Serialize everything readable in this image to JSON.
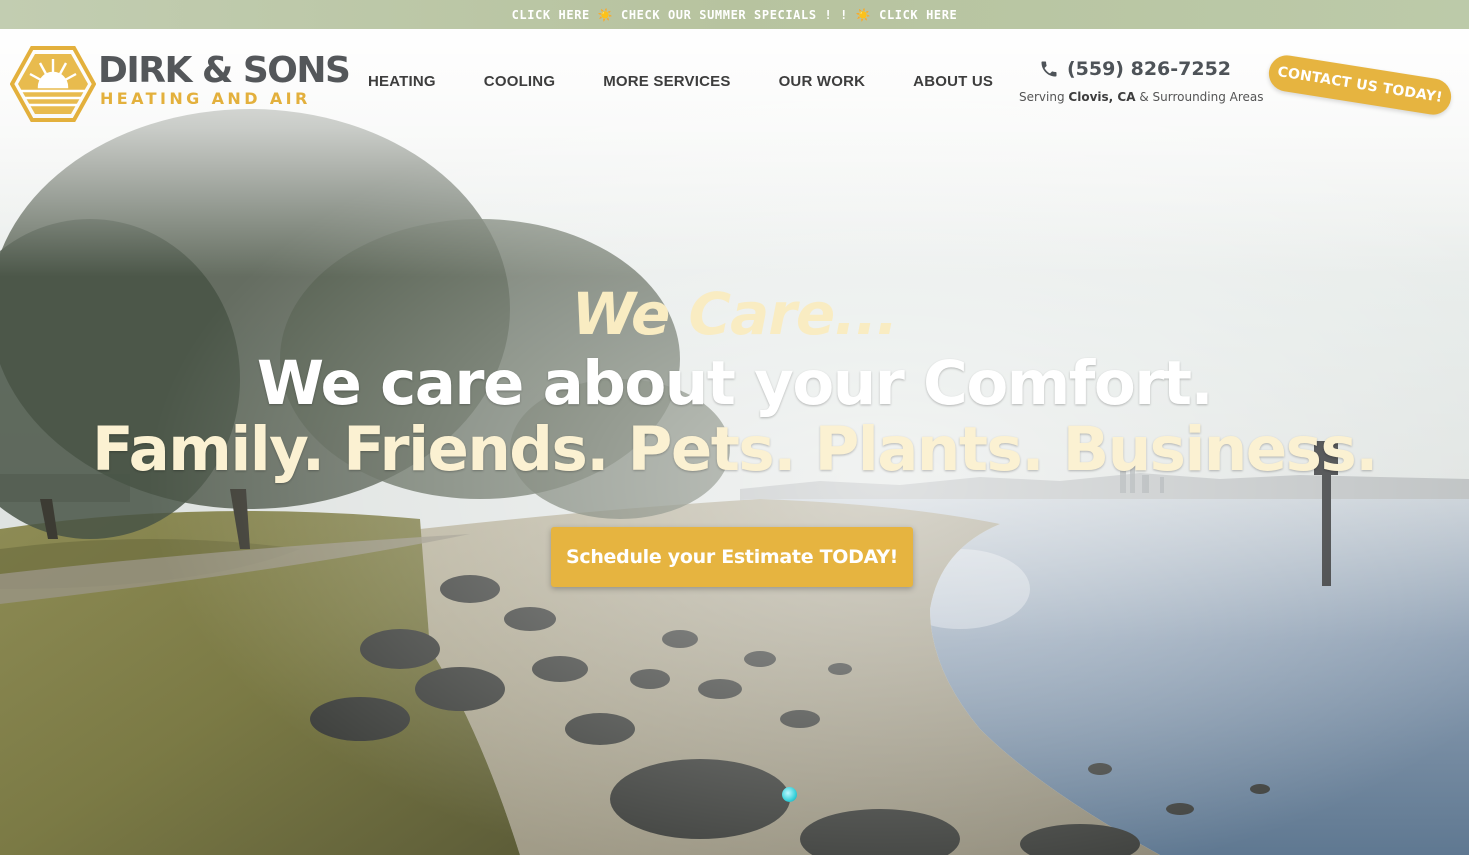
{
  "promo": {
    "text": "CLICK HERE ☀️ CHECK OUR SUMMER SPECIALS ! ! ☀️ CLICK HERE"
  },
  "brand": {
    "name": "DIRK & SONS",
    "tagline": "HEATING AND AIR",
    "logo_icon": "sun-diamond-logo-icon",
    "accent": "#e6b440",
    "text_dark": "#54575a"
  },
  "nav": {
    "items": [
      {
        "label": "HEATING"
      },
      {
        "label": "COOLING"
      },
      {
        "label": "MORE SERVICES"
      },
      {
        "label": "OUR WORK"
      },
      {
        "label": "ABOUT US"
      }
    ]
  },
  "contact": {
    "phone_icon": "phone-icon",
    "phone": "(559) 826-7252",
    "serving_prefix": "Serving",
    "serving_city": "Clovis, CA",
    "serving_suffix": "& Surrounding Areas",
    "cta_label": "CONTACT US TODAY!"
  },
  "hero": {
    "kicker": "We Care...",
    "headline": "We care about your Comfort.",
    "subheadline": "Family. Friends. Pets. Plants. Business.",
    "button_label": "Schedule your Estimate TODAY!"
  }
}
